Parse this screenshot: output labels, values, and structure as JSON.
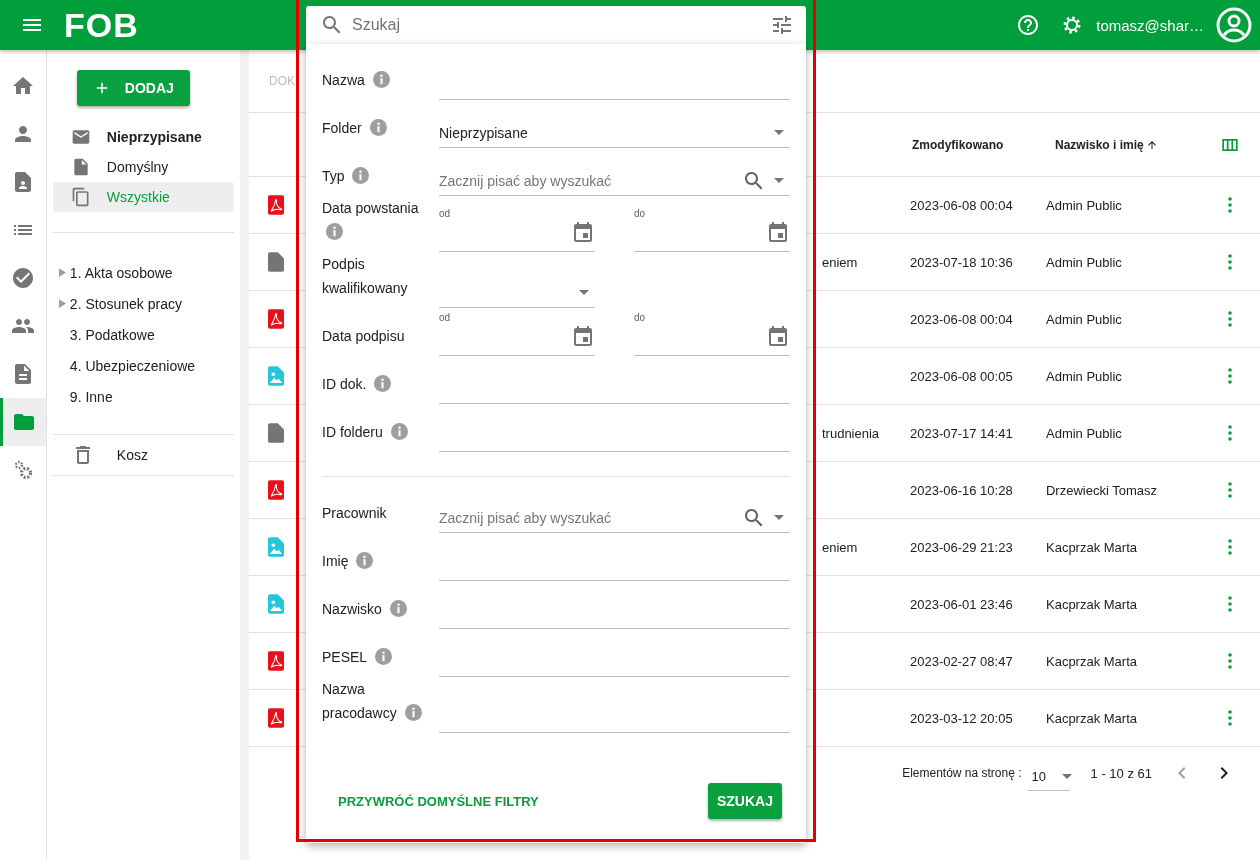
{
  "app_bar": {
    "logo": "FOB",
    "user": "tomasz@shar…"
  },
  "nav_rail": [
    {
      "kind": "home",
      "selected": false
    },
    {
      "kind": "person",
      "selected": false
    },
    {
      "kind": "badge",
      "selected": false
    },
    {
      "kind": "list",
      "selected": false
    },
    {
      "kind": "check",
      "selected": false
    },
    {
      "kind": "people",
      "selected": false
    },
    {
      "kind": "doc",
      "selected": false
    },
    {
      "kind": "folder",
      "selected": true
    },
    {
      "kind": "gears",
      "selected": false
    }
  ],
  "sidebar": {
    "add_button": "DODAJ",
    "views": [
      {
        "kind": "mail",
        "label": "Nieprzypisane",
        "unread": true,
        "selected": false
      },
      {
        "kind": "file",
        "label": "Domyślny",
        "unread": false,
        "selected": false
      },
      {
        "kind": "copy",
        "label": "Wszystkie",
        "unread": false,
        "selected": true
      }
    ],
    "folders": [
      {
        "label": "1. Akta osobowe",
        "expandable": true
      },
      {
        "label": "2. Stosunek pracy",
        "expandable": true
      },
      {
        "label": "3. Podatkowe",
        "expandable": false
      },
      {
        "label": "4. Ubezpieczeniowe",
        "expandable": false
      },
      {
        "label": "9. Inne",
        "expandable": false
      }
    ],
    "trash": "Kosz"
  },
  "breadcrumb": "DOK",
  "table": {
    "columns": [
      {
        "label": "Zmodyfikowano"
      },
      {
        "label": "Nazwisko i imię",
        "sort_ascending": true
      }
    ],
    "rows": [
      {
        "kind": "pdf",
        "modified": "2023-06-08 00:04",
        "person": "Admin Public"
      },
      {
        "kind": "file",
        "column_3": "eniem",
        "modified": "2023-07-18 10:36",
        "person": "Admin Public"
      },
      {
        "kind": "pdf",
        "modified": "2023-06-08 00:04",
        "person": "Admin Public"
      },
      {
        "kind": "image",
        "modified": "2023-06-08 00:05",
        "person": "Admin Public"
      },
      {
        "kind": "file",
        "column_3": "trudnienia",
        "modified": "2023-07-17 14:41",
        "person": "Admin Public"
      },
      {
        "kind": "pdf",
        "modified": "2023-06-16 10:28",
        "person": "Drzewiecki Tomasz"
      },
      {
        "kind": "image",
        "column_3": "eniem",
        "modified": "2023-06-29 21:23",
        "person": "Kacprzak Marta"
      },
      {
        "kind": "image",
        "modified": "2023-06-01 23:46",
        "person": "Kacprzak Marta"
      },
      {
        "kind": "pdf",
        "modified": "2023-02-27 08:47",
        "person": "Kacprzak Marta"
      },
      {
        "kind": "pdf",
        "modified": "2023-03-12 20:05",
        "person": "Kacprzak Marta"
      }
    ]
  },
  "pagination": {
    "label": "Elementów na stronę :",
    "page_size": "10",
    "range": "1 - 10 z 61"
  },
  "search_popup": {
    "search_placeholder": "Szukaj",
    "document_filters": [
      {
        "kind": "text",
        "label": "Nazwa",
        "info": true
      },
      {
        "kind": "select",
        "label": "Folder",
        "info": true,
        "value": "Nieprzypisane"
      },
      {
        "kind": "autocomplete",
        "label": "Typ",
        "info": true,
        "placeholder": "Zacznij pisać aby wyszukać"
      },
      {
        "kind": "date_range",
        "label": "Data powstania",
        "info": true,
        "from_label": "od",
        "to_label": "do"
      },
      {
        "kind": "short_select",
        "label": "Podpis kwalifikowany",
        "info": false
      },
      {
        "kind": "date_range",
        "label": "Data podpisu",
        "info": false,
        "from_label": "od",
        "to_label": "do"
      },
      {
        "kind": "text",
        "label": "ID dok.",
        "info": true
      },
      {
        "kind": "text",
        "label": "ID folderu",
        "info": true
      }
    ],
    "person_filters": [
      {
        "kind": "autocomplete",
        "label": "Pracownik",
        "info": false,
        "placeholder": "Zacznij pisać aby wyszukać"
      },
      {
        "kind": "text",
        "label": "Imię",
        "info": true
      },
      {
        "kind": "text",
        "label": "Nazwisko",
        "info": true
      },
      {
        "kind": "text",
        "label": "PESEL",
        "info": true
      },
      {
        "kind": "text",
        "label": "Nazwa pracodawcy",
        "info": true
      }
    ],
    "reset_button": "PRZYWRÓĆ DOMYŚLNE FILTRY",
    "submit_button": "SZUKAJ"
  }
}
